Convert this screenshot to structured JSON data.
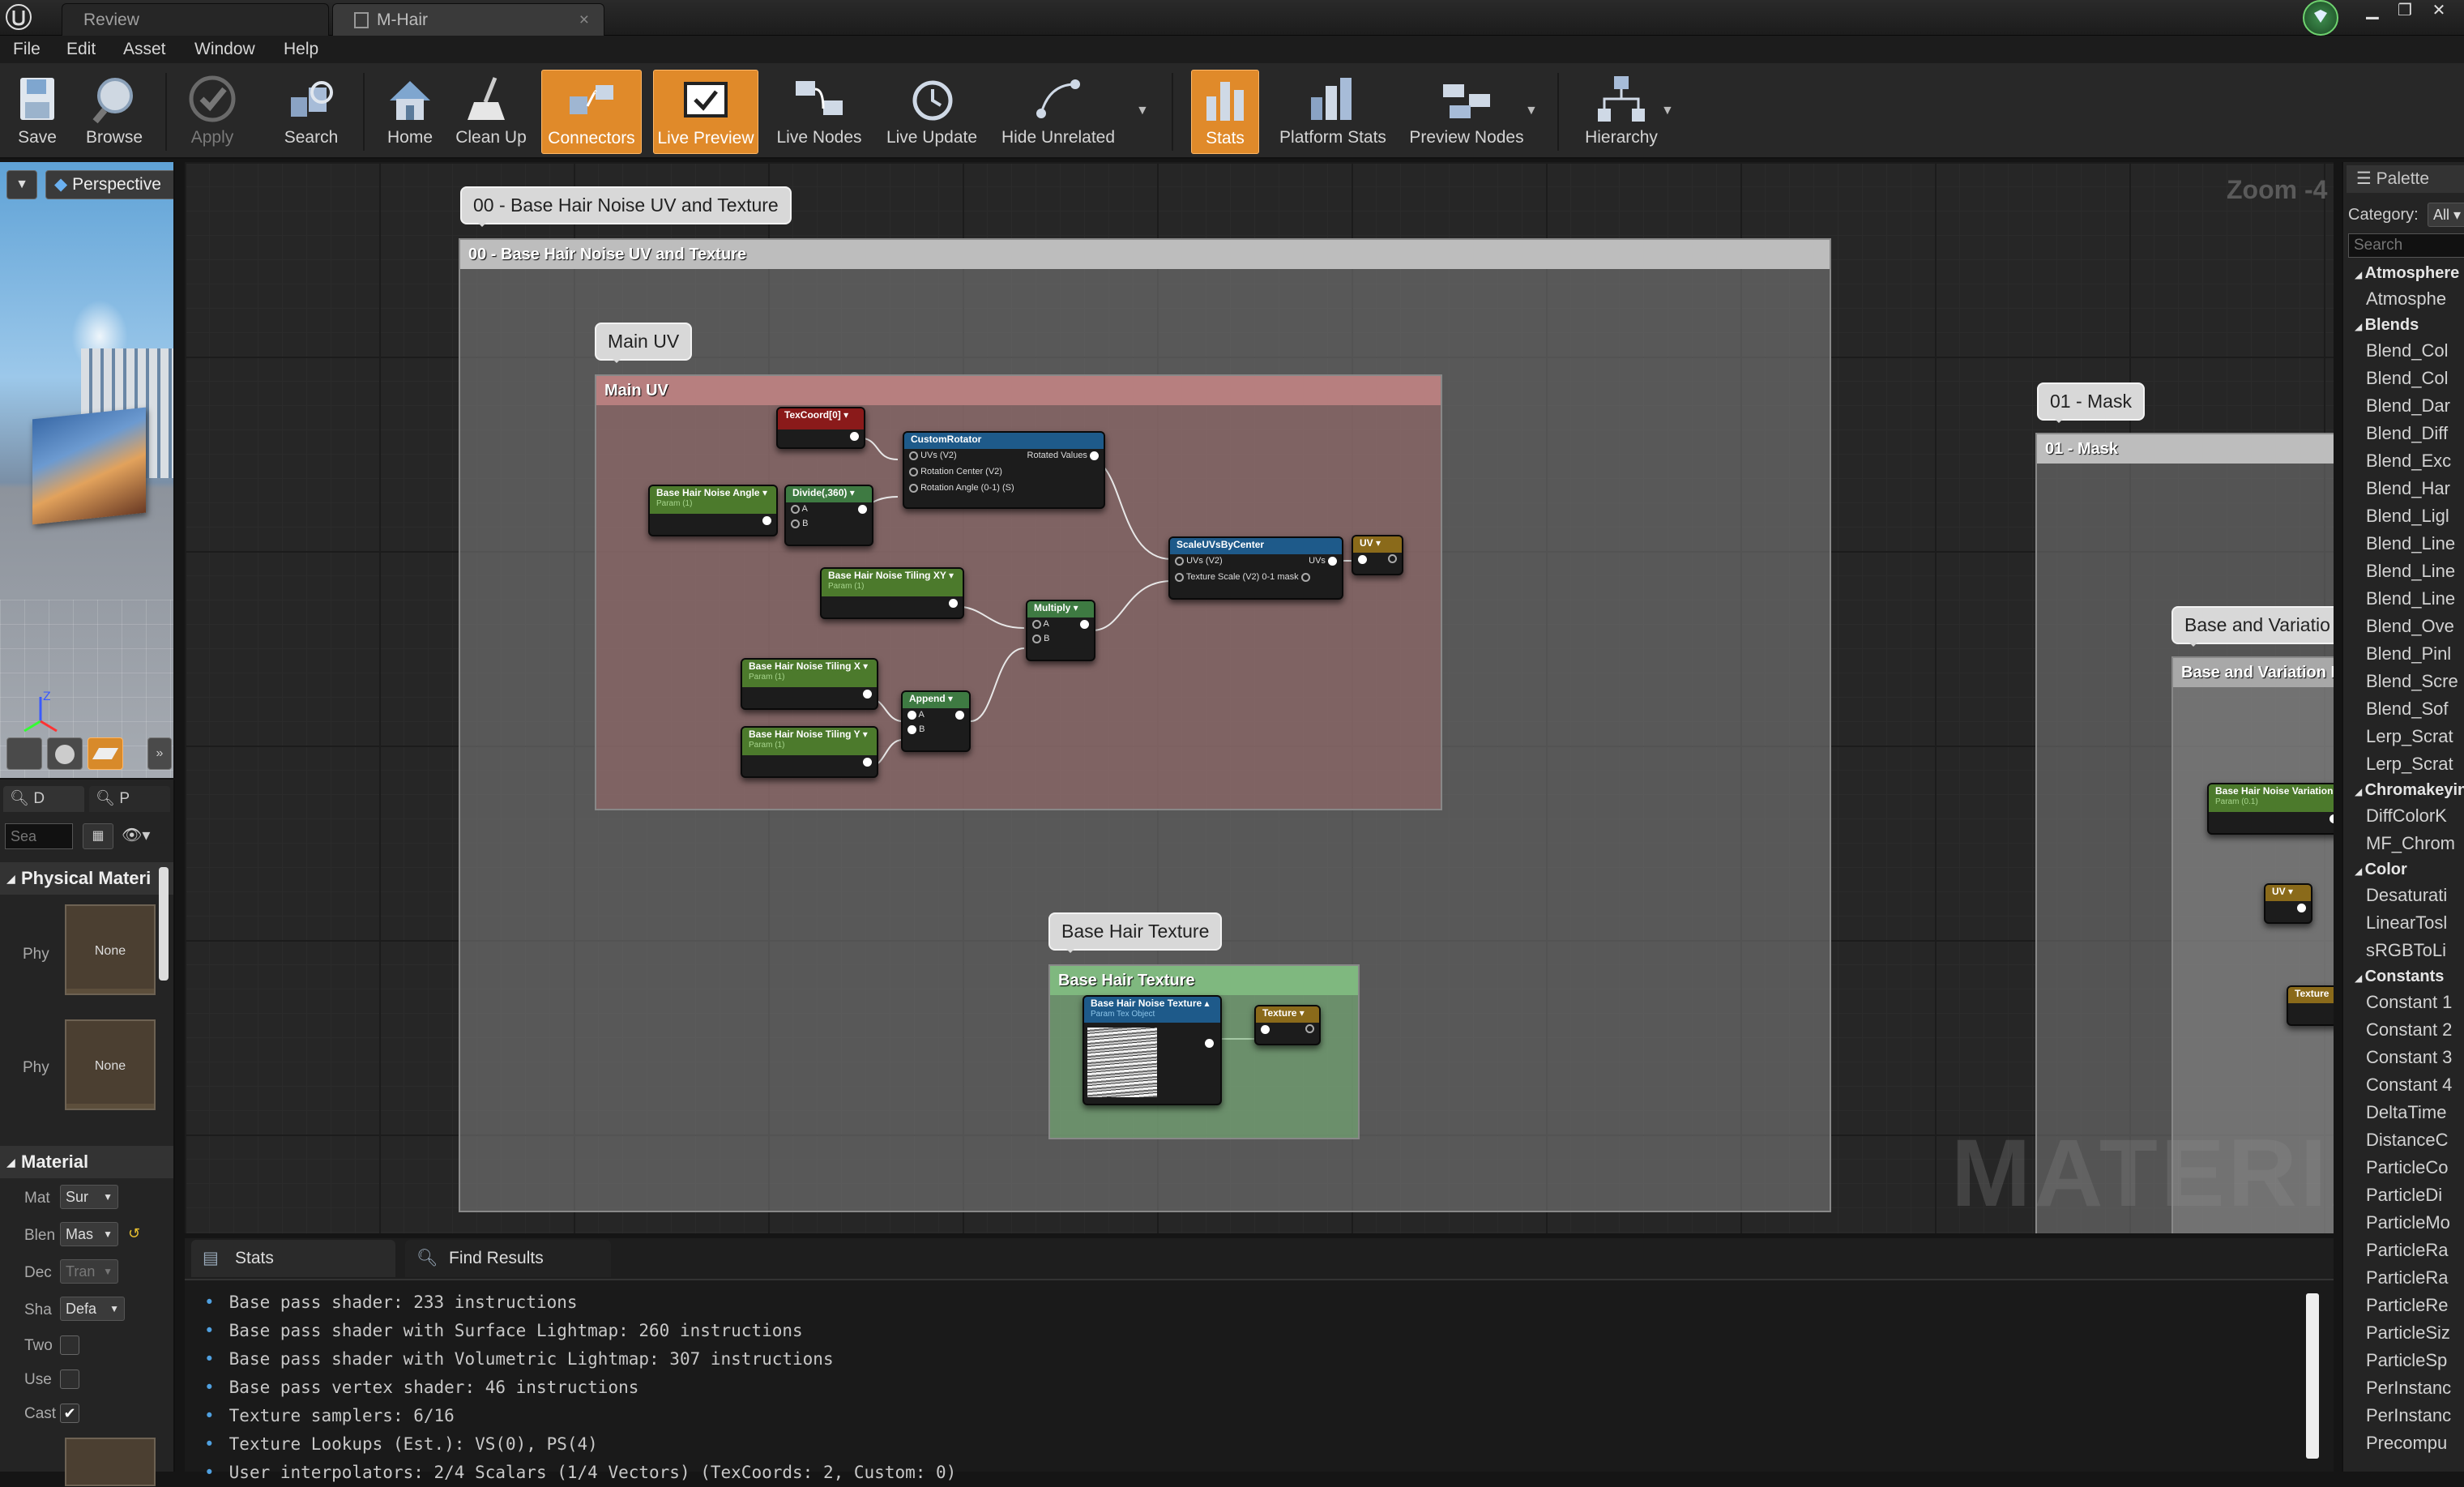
{
  "tabs": [
    {
      "label": "Review"
    },
    {
      "label": "M-Hair"
    }
  ],
  "menu": [
    "File",
    "Edit",
    "Asset",
    "Window",
    "Help"
  ],
  "toolbar": {
    "save": "Save",
    "browse": "Browse",
    "apply": "Apply",
    "search": "Search",
    "home": "Home",
    "cleanup": "Clean Up",
    "connectors": "Connectors",
    "live_preview": "Live Preview",
    "live_nodes": "Live Nodes",
    "live_update": "Live Update",
    "hide_unrelated": "Hide Unrelated",
    "stats": "Stats",
    "platform_stats": "Platform Stats",
    "preview_nodes": "Preview Nodes",
    "hierarchy": "Hierarchy"
  },
  "viewport": {
    "mode": "Perspective"
  },
  "details": {
    "tabs": [
      "D",
      "P"
    ],
    "search_placeholder": "Sea",
    "physical_section": "Physical Materi",
    "phys_label": "Phy",
    "none": "None",
    "material_section": "Material",
    "props": [
      {
        "label": "Mat",
        "value": "Sur"
      },
      {
        "label": "Blen",
        "value": "Mas"
      },
      {
        "label": "Dec",
        "value": "Tran"
      },
      {
        "label": "Sha",
        "value": "Defa"
      },
      {
        "label": "Two",
        "checked": false
      },
      {
        "label": "Use",
        "checked": false
      },
      {
        "label": "Cast",
        "checked": true
      }
    ]
  },
  "graph": {
    "zoom": "Zoom -4",
    "watermark": "MATERIAL",
    "comment00": "00 - Base Hair Noise UV and Texture",
    "main_uv": "Main UV",
    "base_hair_texture": "Base Hair Texture",
    "mask": "01 - Mask",
    "base_variation_bubble": "Base and Variatio",
    "base_variation_head": "Base and Variation F",
    "nodes": {
      "texcoord": "TexCoord[0]",
      "custom_rotator": "CustomRotator",
      "cr_uvs": "UVs (V2)",
      "cr_rotated": "Rotated Values",
      "cr_center": "Rotation Center (V2)",
      "cr_angle": "Rotation Angle (0-1) (S)",
      "noise_angle": "Base Hair Noise Angle",
      "param_s": "Param (1)",
      "divide": "Divide(,360)",
      "pin_a": "A",
      "pin_b": "B",
      "scale_uvs": "ScaleUVsByCenter",
      "su_uvs": "UVs (V2)",
      "su_out": "UVs",
      "su_scale": "Texture Scale (V2) 0-1 mask",
      "uv": "UV",
      "tiling_xy": "Base Hair Noise Tiling XY",
      "multiply": "Multiply",
      "tiling_x": "Base Hair Noise Tiling X",
      "tiling_y": "Base Hair Noise Tiling Y",
      "append": "Append",
      "noise_texture": "Base Hair Noise Texture",
      "param_tex": "Param Tex Object",
      "texture": "Texture",
      "variation_node": "Base Hair Noise Variation C",
      "param_var": "Param (0.1)"
    }
  },
  "palette": {
    "title": "Palette",
    "category_label": "Category:",
    "category_value": "All",
    "search_placeholder": "Search",
    "groups": [
      {
        "name": "Atmosphere",
        "items": [
          "Atmosphe"
        ]
      },
      {
        "name": "Blends",
        "items": [
          "Blend_Col",
          "Blend_Col",
          "Blend_Dar",
          "Blend_Diff",
          "Blend_Exc",
          "Blend_Har",
          "Blend_Ligl",
          "Blend_Line",
          "Blend_Line",
          "Blend_Line",
          "Blend_Ove",
          "Blend_Pinl",
          "Blend_Scre",
          "Blend_Sof",
          "Lerp_Scrat",
          "Lerp_Scrat"
        ]
      },
      {
        "name": "Chromakeyin",
        "items": [
          "DiffColorK",
          "MF_Chrom"
        ]
      },
      {
        "name": "Color",
        "items": [
          "Desaturati",
          "LinearTosl",
          "sRGBToLi"
        ]
      },
      {
        "name": "Constants",
        "items": [
          "Constant 1",
          "Constant 2",
          "Constant 3",
          "Constant 4",
          "DeltaTime",
          "DistanceC",
          "ParticleCo",
          "ParticleDi",
          "ParticleMo",
          "ParticleRa",
          "ParticleRa",
          "ParticleRe",
          "ParticleSiz",
          "ParticleSp",
          "PerInstanc",
          "PerInstanc",
          "Precompu"
        ]
      }
    ]
  },
  "stats": {
    "tab_stats": "Stats",
    "tab_find": "Find Results",
    "lines": [
      "Base pass shader: 233 instructions",
      "Base pass shader with Surface Lightmap: 260 instructions",
      "Base pass shader with Volumetric Lightmap: 307 instructions",
      "Base pass vertex shader: 46 instructions",
      "Texture samplers: 6/16",
      "Texture Lookups (Est.): VS(0), PS(4)",
      "User interpolators: 2/4 Scalars (1/4 Vectors) (TexCoords: 2, Custom: 0)"
    ]
  },
  "colors": {
    "accent": "#e08a2a",
    "param_node": "#4c7a2c",
    "function_node": "#1e5a8a",
    "coord_node": "#8a1a1a",
    "math_node": "#3e7a42",
    "comment_main_uv": "#8a5a5a",
    "comment_texture": "#6fa86f"
  }
}
